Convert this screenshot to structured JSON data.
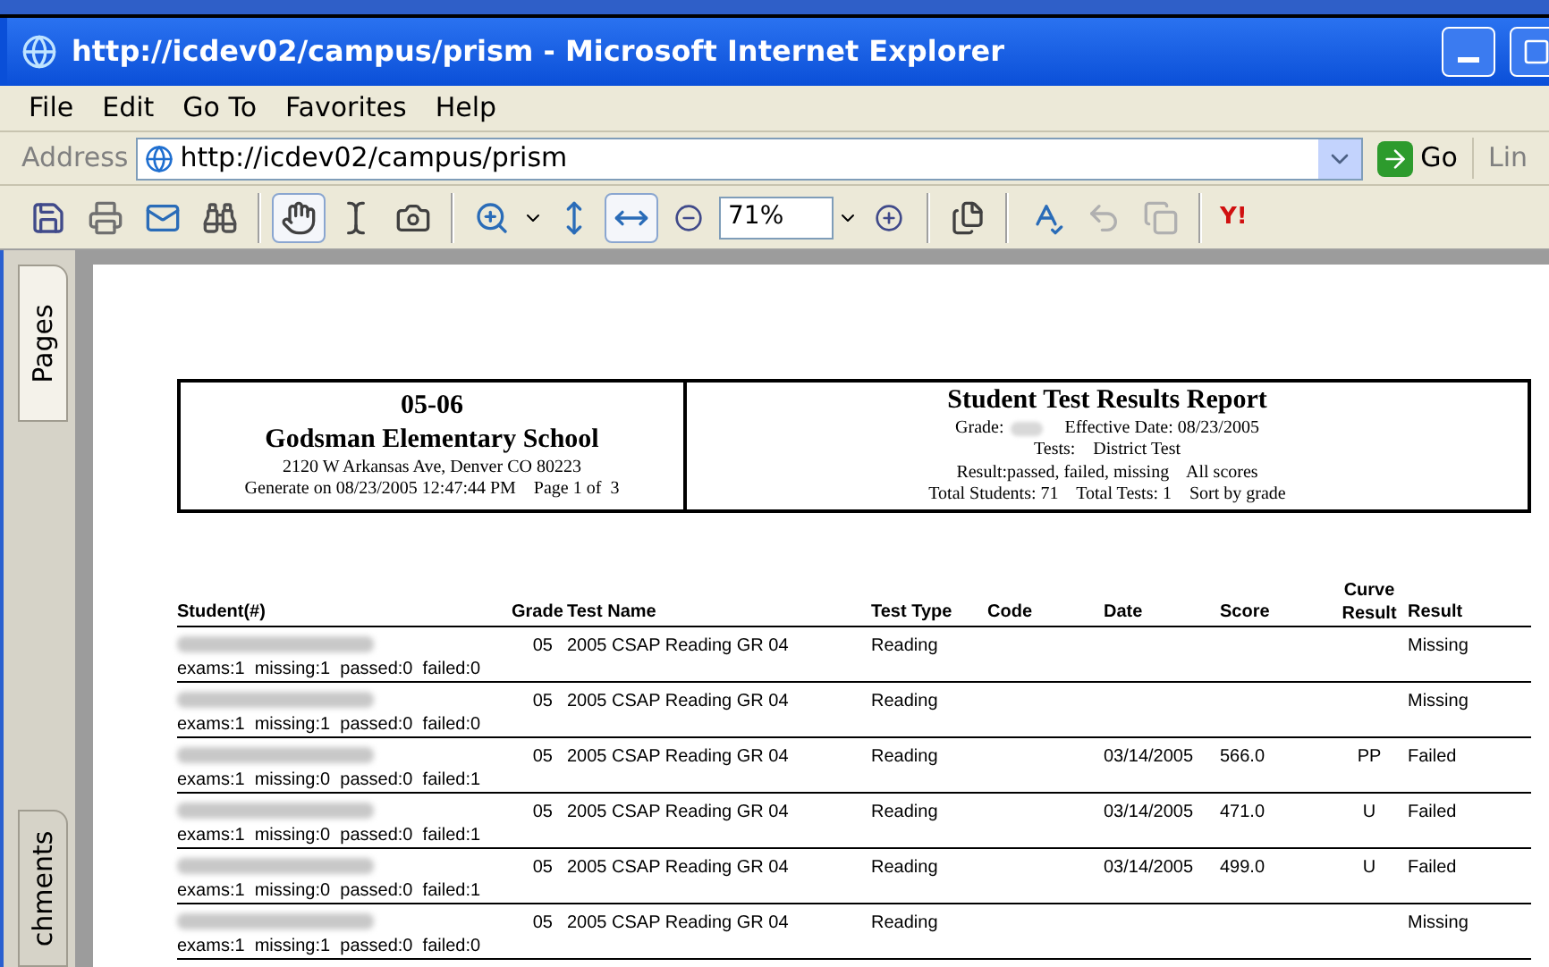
{
  "window": {
    "title": "http://icdev02/campus/prism - Microsoft Internet Explorer"
  },
  "menu": [
    "File",
    "Edit",
    "Go To",
    "Favorites",
    "Help"
  ],
  "address_bar": {
    "label": "Address",
    "value": "http://icdev02/campus/prism",
    "go": "Go",
    "links": "Lin"
  },
  "toolbar": {
    "zoom": "71%",
    "logo": "Y!"
  },
  "side_tabs": [
    {
      "label": "Pages",
      "selected": true
    },
    {
      "label": "chments",
      "selected": false
    }
  ],
  "report": {
    "school_year": "05-06",
    "school": "Godsman Elementary School",
    "address": "2120 W Arkansas Ave, Denver  CO 80223",
    "generated": "Generate on 08/23/2005 12:47:44 PM    Page 1 of  3",
    "title": "Student Test Results Report",
    "grade_label": "Grade:",
    "effective_date": "Effective Date: 08/23/2005",
    "tests": "Tests:    District Test",
    "result_filter": "Result:passed, failed, missing    All scores",
    "totals": "Total Students: 71    Total Tests: 1    Sort by grade"
  },
  "table": {
    "columns": [
      "Student(#)",
      "Grade",
      "Test Name",
      "Test Type",
      "Code",
      "Date",
      "Score",
      "Curve Result",
      "Result"
    ],
    "rows": [
      {
        "grade": "05",
        "test": "2005 CSAP Reading GR 04",
        "type": "Reading",
        "date": "",
        "score": "",
        "curve": "",
        "result": "Missing",
        "summary": "exams:1  missing:1  passed:0  failed:0"
      },
      {
        "grade": "05",
        "test": "2005 CSAP Reading GR 04",
        "type": "Reading",
        "date": "",
        "score": "",
        "curve": "",
        "result": "Missing",
        "summary": "exams:1  missing:1  passed:0  failed:0"
      },
      {
        "grade": "05",
        "test": "2005 CSAP Reading GR 04",
        "type": "Reading",
        "date": "03/14/2005",
        "score": "566.0",
        "curve": "PP",
        "result": "Failed",
        "summary": "exams:1  missing:0  passed:0  failed:1"
      },
      {
        "grade": "05",
        "test": "2005 CSAP Reading GR 04",
        "type": "Reading",
        "date": "03/14/2005",
        "score": "471.0",
        "curve": "U",
        "result": "Failed",
        "summary": "exams:1  missing:0  passed:0  failed:1"
      },
      {
        "grade": "05",
        "test": "2005 CSAP Reading GR 04",
        "type": "Reading",
        "date": "03/14/2005",
        "score": "499.0",
        "curve": "U",
        "result": "Failed",
        "summary": "exams:1  missing:0  passed:0  failed:1"
      },
      {
        "grade": "05",
        "test": "2005 CSAP Reading GR 04",
        "type": "Reading",
        "date": "",
        "score": "",
        "curve": "",
        "result": "Missing",
        "summary": "exams:1  missing:1  passed:0  failed:0"
      }
    ]
  }
}
